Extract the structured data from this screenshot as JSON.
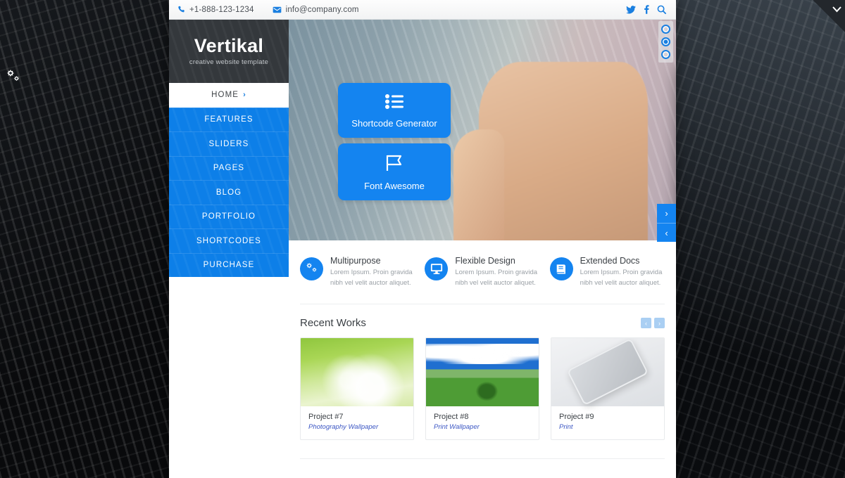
{
  "topbar": {
    "phone": "+1-888-123-1234",
    "email": "info@company.com",
    "phone_icon": "phone-icon",
    "email_icon": "envelope-icon",
    "social": [
      {
        "name": "twitter-icon",
        "label": "Twitter"
      },
      {
        "name": "facebook-icon",
        "label": "Facebook"
      },
      {
        "name": "search-icon",
        "label": "Search"
      }
    ]
  },
  "logo": {
    "title": "Vertikal",
    "tagline": "creative website template"
  },
  "nav": {
    "items": [
      {
        "label": "HOME",
        "active": true,
        "chevron": "›"
      },
      {
        "label": "FEATURES",
        "active": false
      },
      {
        "label": "SLIDERS",
        "active": false
      },
      {
        "label": "PAGES",
        "active": false
      },
      {
        "label": "BLOG",
        "active": false
      },
      {
        "label": "PORTFOLIO",
        "active": false
      },
      {
        "label": "SHORTCODES",
        "active": false
      },
      {
        "label": "PURCHASE",
        "active": false
      }
    ]
  },
  "hero": {
    "boxes": [
      {
        "label": "Shortcode Generator",
        "icon": "list-icon"
      },
      {
        "label": "Font Awesome",
        "icon": "flag-icon"
      }
    ],
    "bullets": [
      {
        "active": false
      },
      {
        "active": true
      },
      {
        "active": false
      }
    ],
    "next_label": "›",
    "prev_label": "‹"
  },
  "features": [
    {
      "title": "Multipurpose",
      "desc": "Lorem Ipsum. Proin gravida nibh vel velit auctor aliquet.",
      "icon": "gears-icon"
    },
    {
      "title": "Flexible Design",
      "desc": "Lorem Ipsum. Proin gravida nibh vel velit auctor aliquet.",
      "icon": "desktop-icon"
    },
    {
      "title": "Extended Docs",
      "desc": "Lorem Ipsum. Proin gravida nibh vel velit auctor aliquet.",
      "icon": "book-icon"
    }
  ],
  "works": {
    "title": "Recent Works",
    "prev_label": "‹",
    "next_label": "›",
    "items": [
      {
        "name": "Project #7",
        "category": "Photography Wallpaper",
        "image": "green-leaves-photo"
      },
      {
        "name": "Project #8",
        "category": "Print Wallpaper",
        "image": "meadow-tree-photo"
      },
      {
        "name": "Project #9",
        "category": "Print",
        "image": "silver-iphone-photo"
      }
    ]
  },
  "desktop": {
    "settings_icon": "gears-settings-icon",
    "corner_toggle_icon": "chevron-down-icon"
  },
  "colors": {
    "accent_blue": "#1484f0",
    "nav_blue": "#0d7fe8",
    "link_blue": "#3c57c4",
    "header_dark": "#34383c"
  }
}
